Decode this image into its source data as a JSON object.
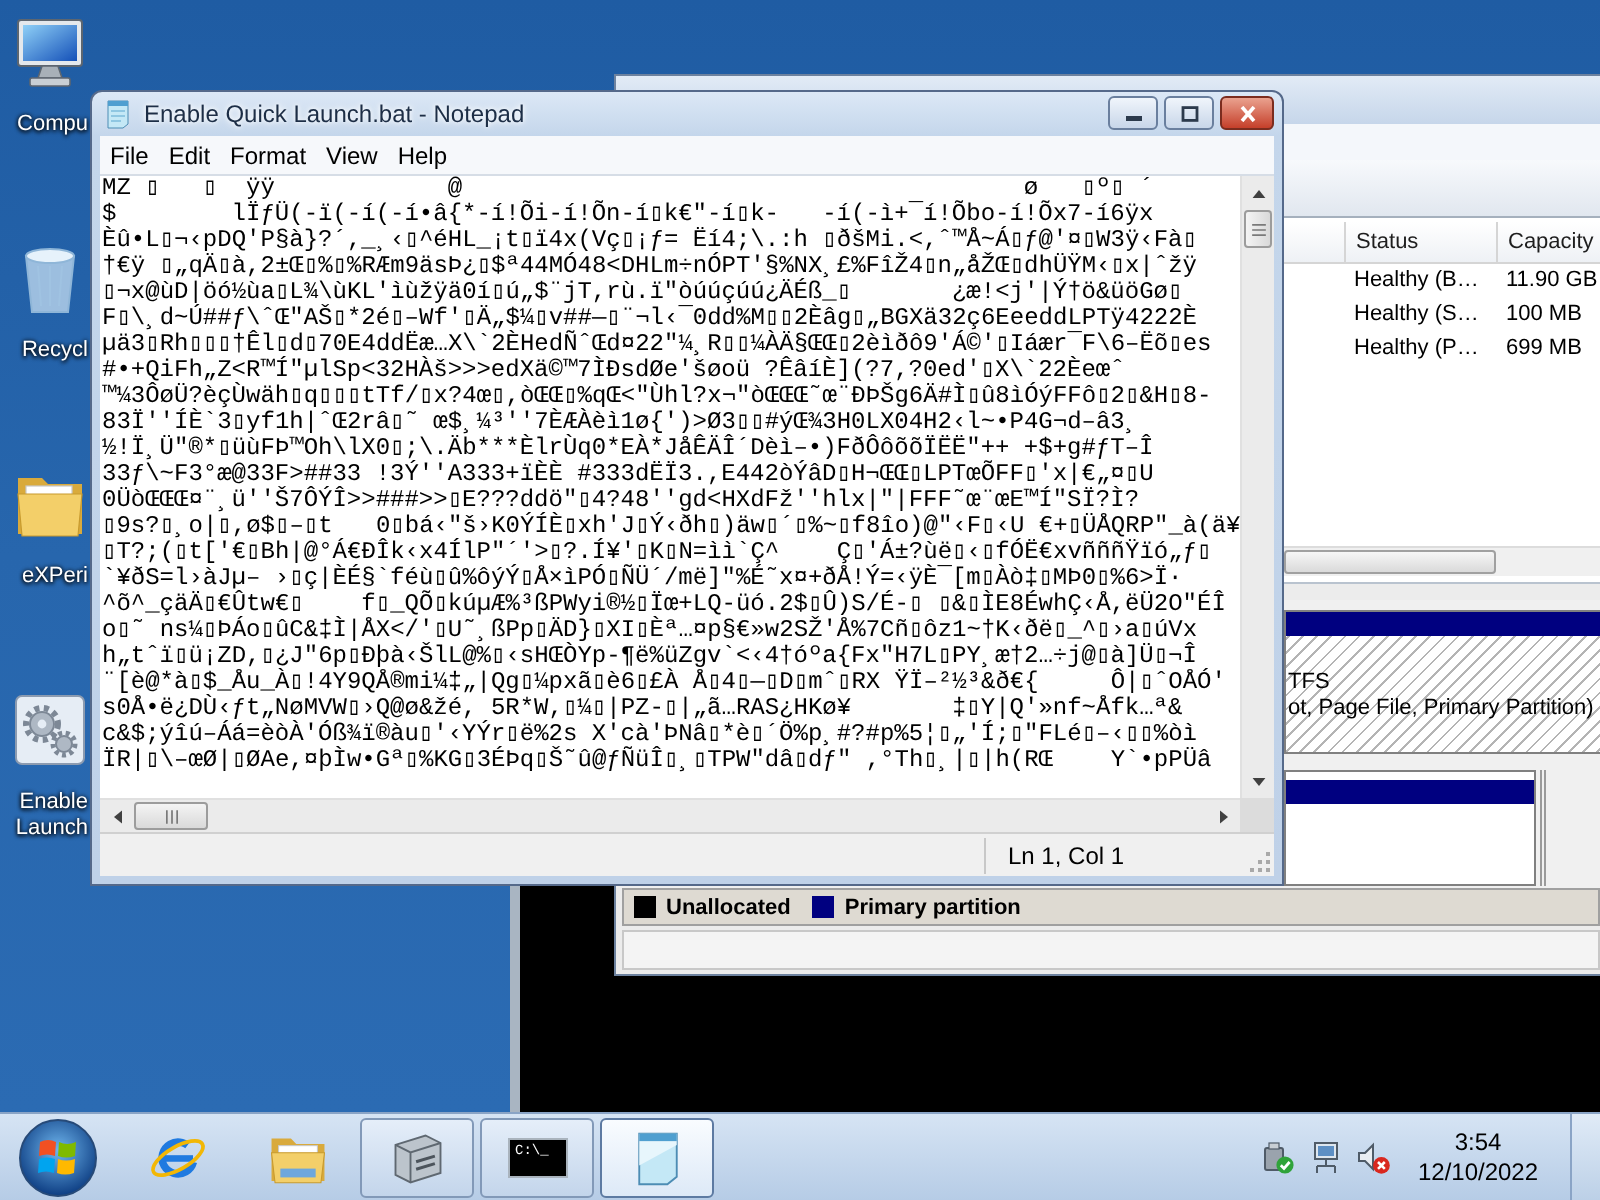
{
  "desktop": {
    "icons": [
      {
        "kind": "computer",
        "lines": [
          "Compu"
        ]
      },
      {
        "kind": "recycle-bin",
        "lines": [
          "Recycl"
        ]
      },
      {
        "kind": "folder",
        "lines": [
          "eXPeri"
        ]
      },
      {
        "kind": "batch-file",
        "lines": [
          "Enable",
          "Launch"
        ]
      }
    ]
  },
  "disk_window": {
    "table": {
      "columns": [
        "Status",
        "Capacity"
      ],
      "rows": [
        [
          "Healthy (B…",
          "11.90 GB"
        ],
        [
          "Healthy (S…",
          "100 MB"
        ],
        [
          "Healthy (P…",
          "699 MB"
        ]
      ]
    },
    "disk_map": {
      "partition_lines": [
        "TFS",
        "ot, Page File, Primary Partition)"
      ]
    },
    "legend": [
      {
        "label": "Unallocated",
        "color": "#000000"
      },
      {
        "label": "Primary partition",
        "color": "#000080"
      }
    ]
  },
  "notepad": {
    "title": "Enable Quick Launch.bat - Notepad",
    "menu": [
      "File",
      "Edit",
      "Format",
      "View",
      "Help"
    ],
    "lines": [
      "MZ ▯   ▯  ÿÿ            @                                       ø   ▯º▯ ´",
      "$        lÏƒÜ(-ï(-í(-í•â{*-í!Õi-í!Õn-í▯k€\"-í▯k-   -í(-ì+¯í!Õbo-í!Õx7-í6ÿx",
      "Èû•L▯¬‹pDQ'P§à}?´,_¸‹▯^éHL_¡t▯ï4x(Vç▯¡ƒ= Ëí4;\\.:h ▯ðšMi.<,ˆ™Å~Á▯ƒ@'¤▯W3ÿ‹Fà▯",
      "†€ÿ ▯„qÄ▯à,2±Œ▯%▯%RÆm9äsÞ¿▯$ª44MÓ48<DHLm÷nÓPT'§%NX¸£%FîŽ4▯n„åŽŒ▯dhÜŸM‹▯x|ˆžÿ",
      "▯¬x@ùD|öó½ùa▯L¾\\ùKL'ìùžÿä0í▯ú„$¨jT,rù.ï\"òúúçúú¿ÄÉß_▯       ¿æ!<j'|Ý†ö&üöGø▯",
      "F▯\\¸d~Ú##ƒ\\ˆŒ\"AŠ▯*2é▯–Wf'▯Ä„$¼▯v##—▯¨¬l‹¯0dd%M▯▯2Èâg▯„BGXä32ç6EeeddLPTÿ4222È",
      "µä3▯Rh▯▯▯†Êl▯d▯70E4ddËæ…X\\`2ÈHedÑˆŒd¤22\"¼¸R▯▯¼ÀÄ§ŒŒ▯2èìðô9'Á©'▯Iáær¯F\\6–Ëõ▯es",
      "#•+QiFh„Z<R™Í\"µlSp<32HÀš>>>edXä©™7ÌÐsdØe'šøoü ?ÊâíÈ](?7,?0ed'▯X\\`22Èeœˆ",
      "™¼3ÔøÜ?èçÙwäh▯q▯▯▯tTf/▯x?4œ▯,òŒŒ▯%qŒ<\"Ùhl?x¬\"òŒŒŒ˜œ¨ÐÞŠg6Ä#Ì▯û8ìÓýFFô▯2▯&H▯8-",
      "83Ï''ÍÈ`3▯yf1h|ˆŒ2râ▯˜ œ$¸¼³''7ÈÆÀèì1ø{')>Ø3▯▯#ýŒ¾3H0LX04H2‹l~•P4G¬d–â3¸",
      "½!Ï¸Ü\"®*▯üùFÞ™Oh\\lX0▯;\\.Äb***ÈlrÙq0*EÀ*JåÊÄÎ´Dèì–•)FðÔôõõÏËË\"++ +$+g#ƒT–Î",
      "33ƒ\\~F3°æ@33F>##33 !3Ý''A333+ïÈÈ #333dËÏ3.,E442òÝâD▯H¬ŒŒ▯LPTœÕFF▯'x|€„¤▯U",
      "0ÜòŒŒŒ¤¨¸ü''Š7ÔÝÎ>>###>>▯E???ddö\"▯4?48''gd<HXdFž''hlx|\"|FFF˜œ¨œE™Í\"SÏ?Ì?",
      "▯9s?▯¸o|▯,ø$▯–▯t   0▯bá‹\"š›K0ÝÍÈ▯xh'J▯Ý‹ðh▯)äw▯´▯%~▯f8îo)@\"‹F▯‹U €+▯ÜÅQRP\"_à(ä¥",
      "▯T?;(▯t['€▯Bh|@°Á€ÐÎk‹x4ÍlP\"´'>▯?.Í¥'▯K▯N=ìì`Ç^    Ç▯'Á±?ùë▯‹▯fÓË€xvñññŸïó„ƒ▯",
      "`¥ðS=l›àJµ– ›▯ç|ÈÉ§`féù▯û%ôýÝ▯Å×ìPÓ▯ÑÜ´/më]\"%É˜x¤+ðÅ!Ý=‹ÿÈ¯[m▯Àò‡▯MÞ0▯%6>Ï·",
      "^õ^_çäÄ▯€Ûtw€▯    f▯_QÕ▯kúµÆ%³ßPWyi®½▯Ïœ+LQ-üó.2$▯Û)S/É-▯ ▯&▯ÌE8ÉwhÇ‹Å,ëÜ2O\"ÉÎ",
      "o▯˜ ns¼▯ÞÁo▯ûC&‡Ì|ÅX</'▯U˜¸ßPp▯ÄD}▯XI▯Èª…¤p§€»w2SŽ'Å%7Cñ▯ôz1~†K‹ðë▯_^▯›a▯úVx",
      "h„tˆï▯ü¡ZD,▯¿J\"6p▯Ðþà‹ŠlL@%▯‹sHŒÒYp-¶ë%üZgv`<‹4†óºa{Fx\"H7L▯PY¸æ†2…÷j@▯à]Ü▯¬Î",
      "¨[è@*à▯$_Åu_À▯!4Y9QÅ®mi¼‡„|Qg▯¼pxã▯è6▯£À Å▯4▯—▯D▯mˆ▯RX ŸÏ–²½³&ð€{     Ô|▯ˆOÅÓ'",
      "s0Å•ë¿DÙ‹ƒt„NøMVW▯›Q@ø&žé, 5R*W,▯¼▯|PZ-▯|„ã…RAS¿HKø¥       ‡▯Y|Q'»nf~Åfk…ª&",
      "c&$;ýîú–Áá=èòÀ'Óß¾ï®àu▯'‹YÝr▯ë%2s X'cà'ÞNâ▯*è▯´Ö%p¸#?#p%5¦▯„'Í;▯\"FLé▯–‹▯▯%òì",
      "ÏR|▯\\–œØ|▯ØAe,¤þÌw•Gª▯%KG▯3ÉÞq▯Š˜û@ƒÑüÎ▯¸▯TPW\"dâ▯dƒ\" ,°Th▯¸|▯|h(RŒ    Y`•pPÜâ"
    ],
    "status": "Ln 1, Col 1"
  },
  "taskbar": {
    "buttons": [
      {
        "kind": "browser",
        "running": false,
        "selected": false
      },
      {
        "kind": "explorer",
        "running": false,
        "selected": false
      },
      {
        "kind": "disk-management",
        "running": true,
        "selected": false
      },
      {
        "kind": "console",
        "running": true,
        "selected": false,
        "glyph": "C:\\_"
      },
      {
        "kind": "notepad",
        "running": true,
        "selected": true
      }
    ],
    "tray": [
      {
        "kind": "safely-remove"
      },
      {
        "kind": "network"
      },
      {
        "kind": "volume",
        "muted": true
      }
    ],
    "clock": {
      "time": "3:54",
      "date": "12/10/2022"
    }
  }
}
